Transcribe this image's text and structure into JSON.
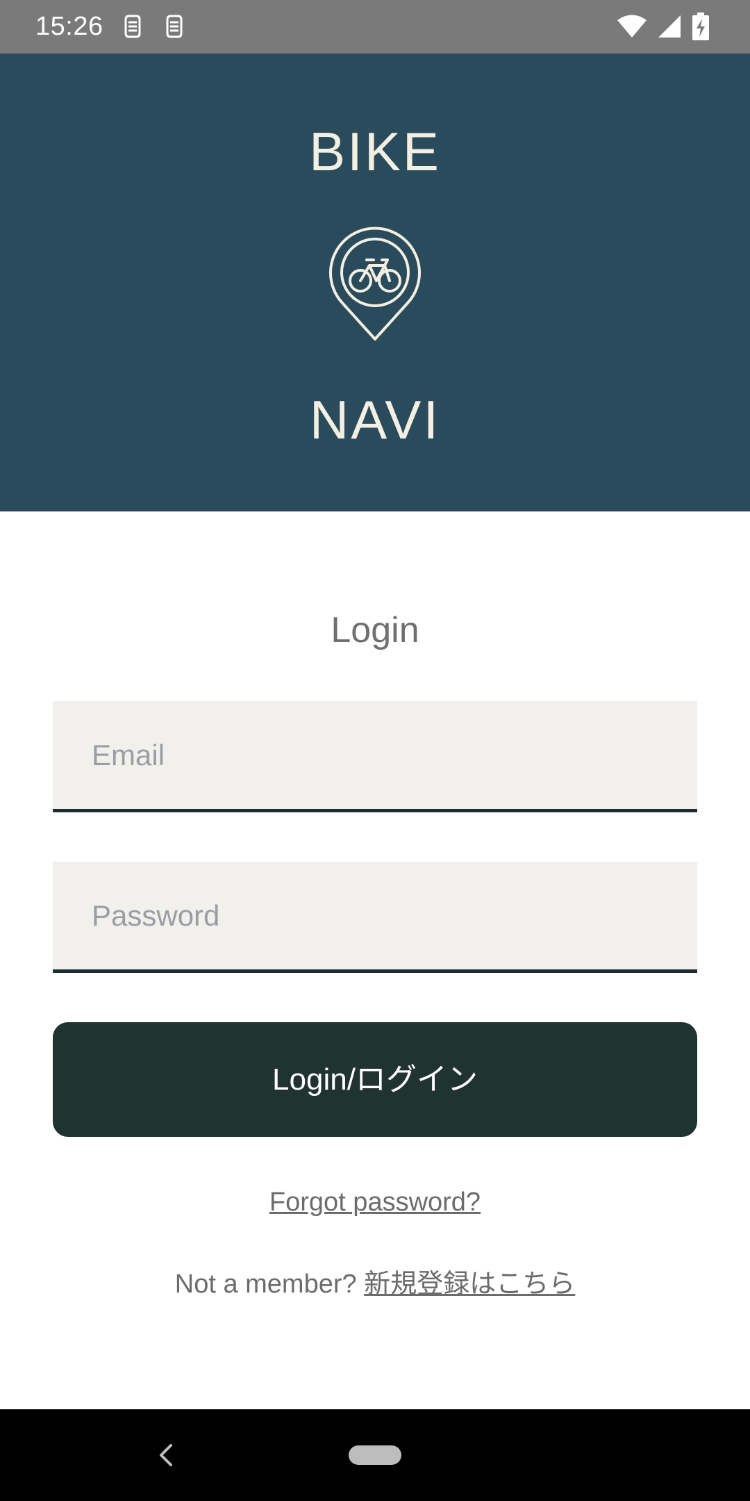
{
  "status_bar": {
    "time": "15:26",
    "left_icons": [
      "notification-app-icon",
      "notification-app-icon"
    ],
    "right_icons": [
      "wifi-icon",
      "signal-icon",
      "battery-charging-icon"
    ]
  },
  "header": {
    "brand_top": "BIKE",
    "brand_bottom": "NAVI",
    "logo_icon": "bike-location-pin-icon",
    "background_color": "#2a4b5b",
    "accent_color": "#f3efe3"
  },
  "form": {
    "title": "Login",
    "email": {
      "value": "",
      "placeholder": "Email"
    },
    "password": {
      "value": "",
      "placeholder": "Password"
    },
    "login_button": "Login/ログイン",
    "forgot_link": "Forgot password?",
    "signup_prefix": "Not a member? ",
    "signup_link": "新規登録はこちら",
    "button_color": "#213331"
  },
  "nav_bar": {
    "icons": [
      "back-icon",
      "home-pill-icon"
    ]
  }
}
